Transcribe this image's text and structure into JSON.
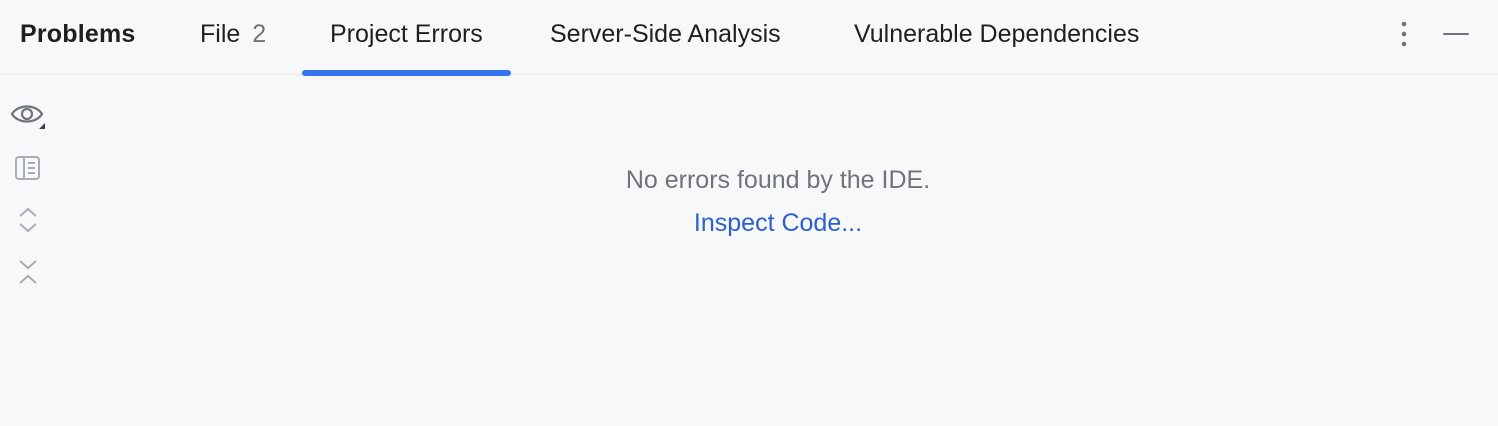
{
  "panel": {
    "title": "Problems"
  },
  "tabs": [
    {
      "label": "File",
      "count": "2",
      "active": false
    },
    {
      "label": "Project Errors",
      "active": true
    },
    {
      "label": "Server-Side Analysis",
      "active": false
    },
    {
      "label": "Vulnerable Dependencies",
      "active": false
    }
  ],
  "header_actions": {
    "more_icon": "more-vertical-icon",
    "minimize_icon": "minimize-icon"
  },
  "toolbar": [
    {
      "icon": "eye-icon"
    },
    {
      "icon": "preview-panel-icon"
    },
    {
      "icon": "expand-all-icon"
    },
    {
      "icon": "collapse-all-icon"
    }
  ],
  "empty_state": {
    "message": "No errors found by the IDE.",
    "link": "Inspect Code..."
  },
  "colors": {
    "background": "#f7f8fa",
    "accent": "#3574f0",
    "link": "#2b5fd0",
    "muted_text": "#6f737a"
  }
}
